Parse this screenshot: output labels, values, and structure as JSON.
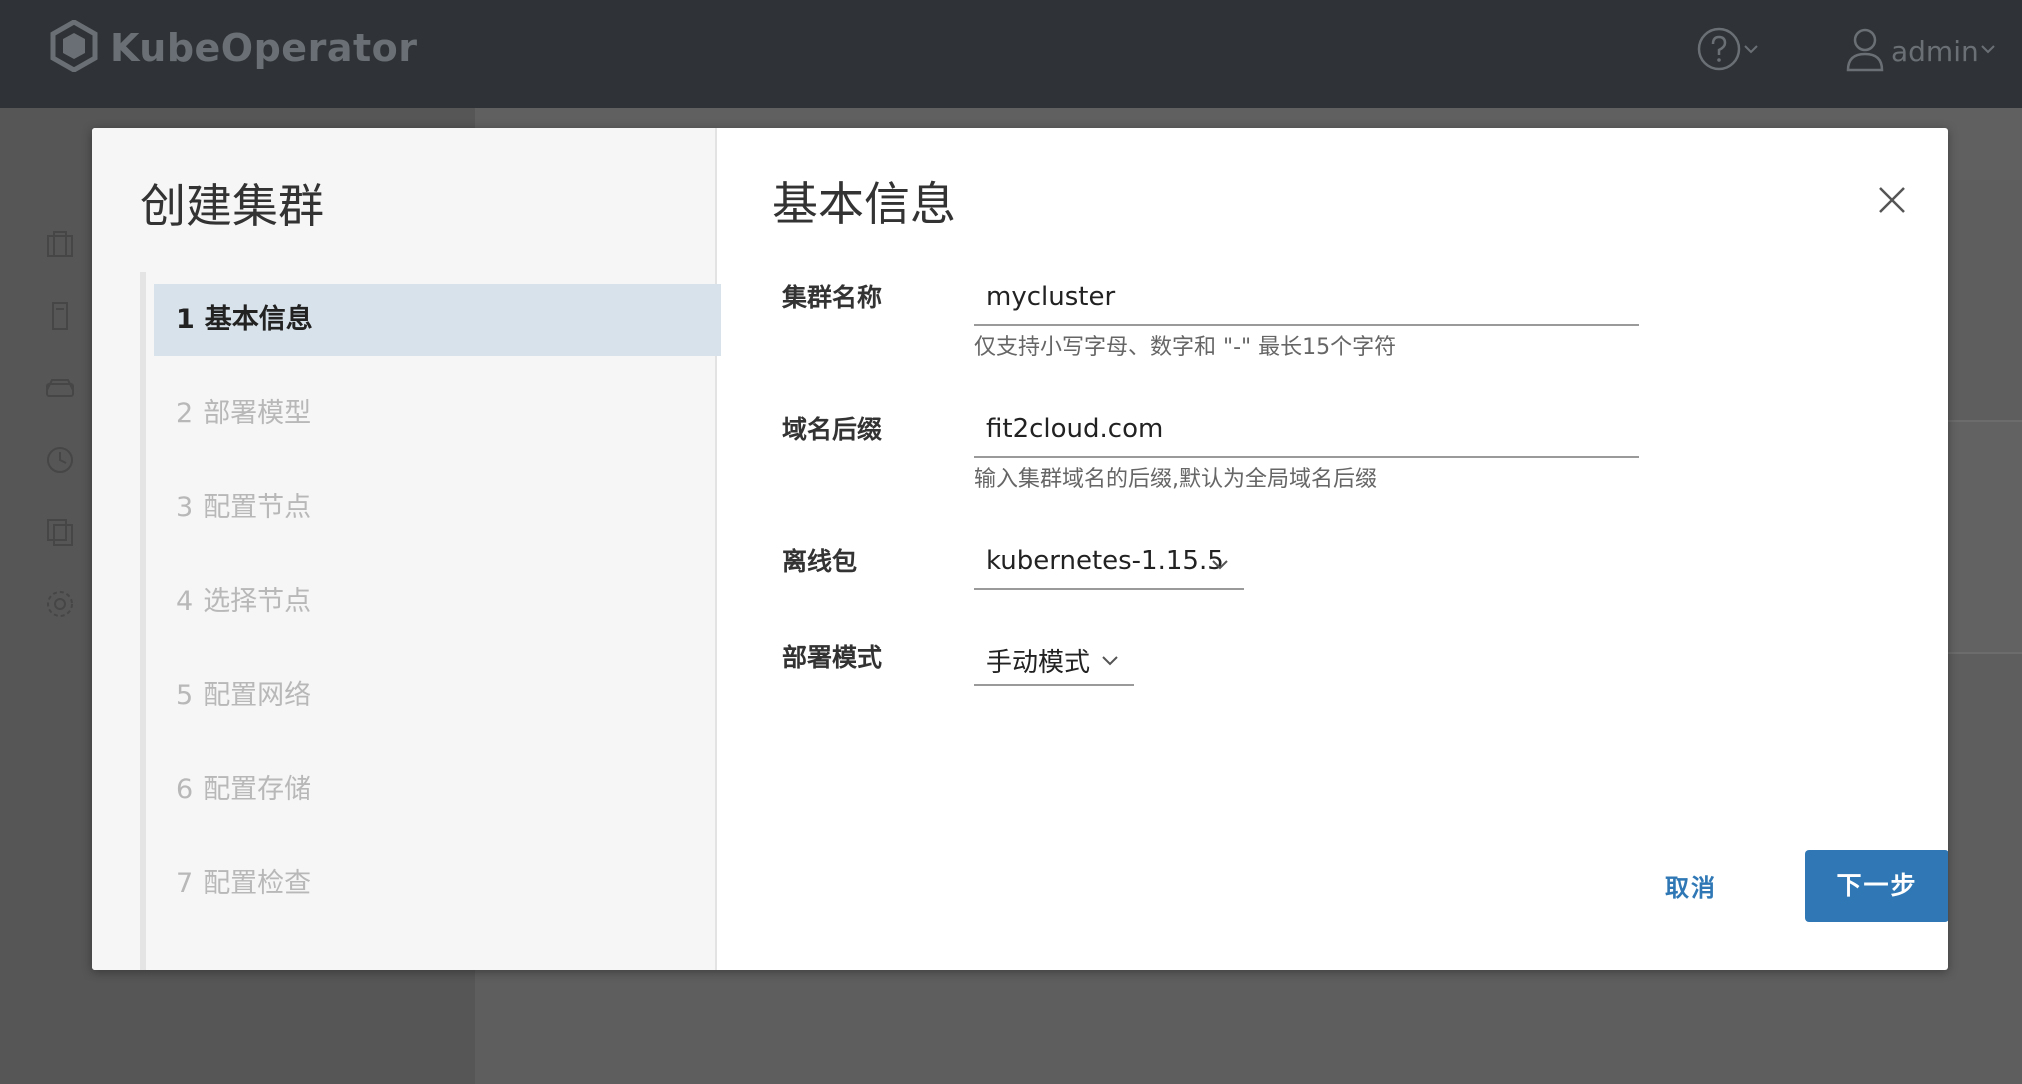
{
  "header": {
    "brand": "KubeOperator",
    "user": "admin",
    "icons": [
      "logo-hexagon-icon",
      "help-icon",
      "user-icon",
      "chevron-down-icon"
    ]
  },
  "modal": {
    "nav_title": "创建集群",
    "steps": [
      {
        "num": "1",
        "label": "基本信息"
      },
      {
        "num": "2",
        "label": "部署模型"
      },
      {
        "num": "3",
        "label": "配置节点"
      },
      {
        "num": "4",
        "label": "选择节点"
      },
      {
        "num": "5",
        "label": "配置网络"
      },
      {
        "num": "6",
        "label": "配置存储"
      },
      {
        "num": "7",
        "label": "配置检查"
      }
    ],
    "active_step": 1,
    "content_title": "基本信息",
    "form": {
      "cluster_name": {
        "label": "集群名称",
        "value": "mycluster",
        "hint": "仅支持小写字母、数字和 \"-\" 最长15个字符"
      },
      "domain_suffix": {
        "label": "域名后缀",
        "value": "fit2cloud.com",
        "hint": "输入集群域名的后缀,默认为全局域名后缀"
      },
      "offline_package": {
        "label": "离线包",
        "value": "kubernetes-1.15.5"
      },
      "deploy_mode": {
        "label": "部署模式",
        "value": "手动模式"
      }
    },
    "buttons": {
      "cancel": "取消",
      "next": "下一步"
    }
  }
}
